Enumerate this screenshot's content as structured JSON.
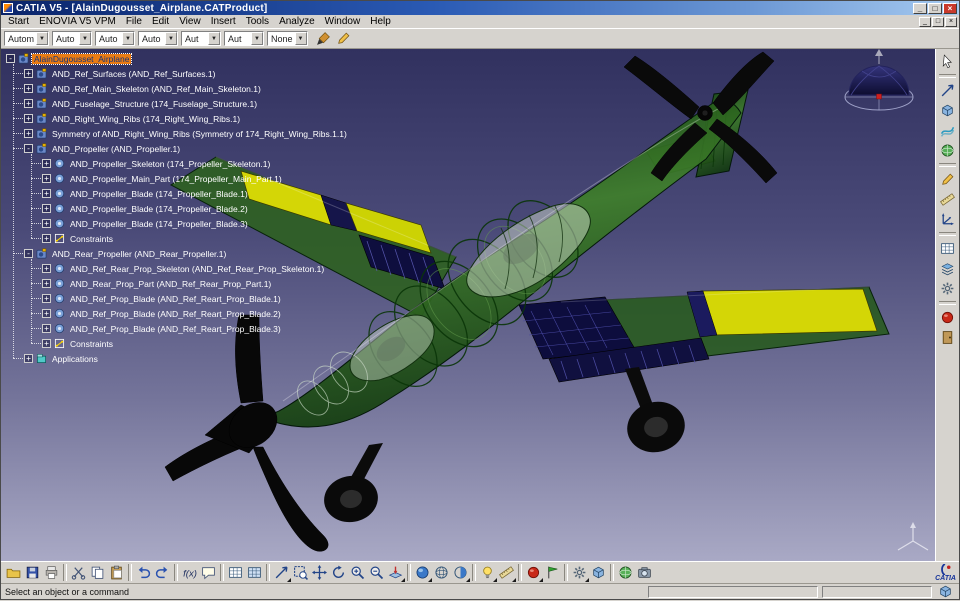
{
  "window": {
    "title": "CATIA V5 - [AlainDugousset_Airplane.CATProduct]",
    "buttons": [
      {
        "name": "minimize-button",
        "glyph": "_"
      },
      {
        "name": "maximize-button",
        "glyph": "□"
      },
      {
        "name": "close-button",
        "glyph": "×"
      }
    ],
    "mdi_buttons": [
      {
        "name": "mdi-minimize-button",
        "glyph": "_"
      },
      {
        "name": "mdi-restore-button",
        "glyph": "□"
      },
      {
        "name": "mdi-close-button",
        "glyph": "×"
      }
    ]
  },
  "menu": {
    "items": [
      "Start",
      "ENOVIA V5 VPM",
      "File",
      "Edit",
      "View",
      "Insert",
      "Tools",
      "Analyze",
      "Window",
      "Help"
    ]
  },
  "toolbar": {
    "combos": [
      {
        "name": "auto-color-combo",
        "value": "Autom"
      },
      {
        "name": "auto-1-combo",
        "value": "Auto"
      },
      {
        "name": "auto-2-combo",
        "value": "Auto"
      },
      {
        "name": "auto-3-combo",
        "value": "Auto"
      },
      {
        "name": "aut-1-combo",
        "value": "Aut"
      },
      {
        "name": "aut-2-combo",
        "value": "Aut"
      },
      {
        "name": "point-symbol-combo",
        "value": "None"
      }
    ],
    "icons": [
      {
        "name": "paint-icon",
        "type": "brush"
      },
      {
        "name": "pencil-icon",
        "type": "pencil"
      }
    ]
  },
  "tree": {
    "items": [
      {
        "label": "AlainDugousset_Airplane",
        "level": 0,
        "expand": "minus",
        "icon": "product",
        "selected": true
      },
      {
        "label": "AND_Ref_Surfaces (AND_Ref_Surfaces.1)",
        "level": 1,
        "expand": "plus",
        "icon": "product",
        "selected": false
      },
      {
        "label": "AND_Ref_Main_Skeleton (AND_Ref_Main_Skeleton.1)",
        "level": 1,
        "expand": "plus",
        "icon": "product",
        "selected": false
      },
      {
        "label": "AND_Fuselage_Structure (174_Fuselage_Structure.1)",
        "level": 1,
        "expand": "plus",
        "icon": "product",
        "selected": false
      },
      {
        "label": "AND_Right_Wing_Ribs (174_Right_Wing_Ribs.1)",
        "level": 1,
        "expand": "plus",
        "icon": "product",
        "selected": false
      },
      {
        "label": "Symmetry of AND_Right_Wing_Ribs (Symmetry of 174_Right_Wing_Ribs.1.1)",
        "level": 1,
        "expand": "plus",
        "icon": "product",
        "selected": false
      },
      {
        "label": "AND_Propeller (AND_Propeller.1)",
        "level": 1,
        "expand": "minus",
        "icon": "product",
        "selected": false
      },
      {
        "label": "AND_Propeller_Skeleton (174_Propeller_Skeleton.1)",
        "level": 2,
        "expand": "plus",
        "icon": "part",
        "selected": false
      },
      {
        "label": "AND_Propeller_Main_Part (174_Propeller_Main_Part.1)",
        "level": 2,
        "expand": "plus",
        "icon": "part",
        "selected": false
      },
      {
        "label": "AND_Propeller_Blade (174_Propeller_Blade.1)",
        "level": 2,
        "expand": "plus",
        "icon": "part",
        "selected": false
      },
      {
        "label": "AND_Propeller_Blade (174_Propeller_Blade.2)",
        "level": 2,
        "expand": "plus",
        "icon": "part",
        "selected": false
      },
      {
        "label": "AND_Propeller_Blade (174_Propeller_Blade.3)",
        "level": 2,
        "expand": "plus",
        "icon": "part",
        "selected": false
      },
      {
        "label": "Constraints",
        "level": 2,
        "expand": "plus",
        "icon": "constraints",
        "selected": false
      },
      {
        "label": "AND_Rear_Propeller (AND_Rear_Propeller.1)",
        "level": 1,
        "expand": "minus",
        "icon": "product",
        "selected": false
      },
      {
        "label": "AND_Ref_Rear_Prop_Skeleton (AND_Ref_Rear_Prop_Skeleton.1)",
        "level": 2,
        "expand": "plus",
        "icon": "part",
        "selected": false
      },
      {
        "label": "AND_Rear_Prop_Part (AND_Ref_Rear_Prop_Part.1)",
        "level": 2,
        "expand": "plus",
        "icon": "part",
        "selected": false
      },
      {
        "label": "AND_Ref_Prop_Blade (AND_Ref_Reart_Prop_Blade.1)",
        "level": 2,
        "expand": "plus",
        "icon": "part",
        "selected": false
      },
      {
        "label": "AND_Ref_Prop_Blade (AND_Ref_Reart_Prop_Blade.2)",
        "level": 2,
        "expand": "plus",
        "icon": "part",
        "selected": false
      },
      {
        "label": "AND_Ref_Prop_Blade (AND_Ref_Reart_Prop_Blade.3)",
        "level": 2,
        "expand": "plus",
        "icon": "part",
        "selected": false
      },
      {
        "label": "Constraints",
        "level": 2,
        "expand": "plus",
        "icon": "constraints",
        "selected": false
      },
      {
        "label": "Applications",
        "level": 1,
        "expand": "plus",
        "icon": "applications",
        "selected": false
      }
    ]
  },
  "viewport": {
    "colors": {
      "top": "#31315f",
      "bottom": "#a9a9c5",
      "selection_bg": "#e97b13",
      "selection_text": "#16347c",
      "fuselage_green": "#3f7f2b",
      "panel_yellow": "#d4d606",
      "structure_navy": "#10103f",
      "propeller_black": "#0a0a0a"
    }
  },
  "right_toolbar": {
    "icons": [
      {
        "name": "select-icon",
        "type": "cursor"
      },
      {
        "type": "sep"
      },
      {
        "name": "fly-workbench-icon",
        "type": "jet"
      },
      {
        "name": "part-workbench-icon",
        "type": "cube"
      },
      {
        "name": "surface-workbench-icon",
        "type": "surface"
      },
      {
        "name": "dmu-world-icon",
        "type": "world"
      },
      {
        "type": "sep"
      },
      {
        "name": "sketcher-icon",
        "type": "pencil"
      },
      {
        "name": "measure-tool-icon",
        "type": "ruler"
      },
      {
        "name": "axis-system-icon",
        "type": "axis3"
      },
      {
        "type": "sep"
      },
      {
        "name": "grid-tool-icon",
        "type": "grid"
      },
      {
        "name": "layers-icon",
        "type": "layers"
      },
      {
        "name": "settings-gear-icon",
        "type": "gear"
      },
      {
        "type": "sep"
      },
      {
        "name": "apply-material-icon",
        "type": "redball"
      },
      {
        "name": "exit-workbench-icon",
        "type": "door"
      }
    ]
  },
  "bottom_toolbar": {
    "logo": "CATIA",
    "icons": [
      {
        "name": "open-icon",
        "type": "folder"
      },
      {
        "name": "save-icon",
        "type": "floppy"
      },
      {
        "name": "print-icon",
        "type": "printer"
      },
      {
        "type": "sep"
      },
      {
        "name": "cut-icon",
        "type": "scissors"
      },
      {
        "name": "copy-icon",
        "type": "copy"
      },
      {
        "name": "paste-icon",
        "type": "paste"
      },
      {
        "type": "sep"
      },
      {
        "name": "undo-icon",
        "type": "undo"
      },
      {
        "name": "redo-icon",
        "type": "redo"
      },
      {
        "type": "sep"
      },
      {
        "name": "knowledge-fx-icon",
        "type": "fx"
      },
      {
        "name": "annotation-icon",
        "type": "bubble"
      },
      {
        "type": "sep"
      },
      {
        "name": "design-table-icon",
        "type": "grid"
      },
      {
        "name": "catalog-icon",
        "type": "gridblue"
      },
      {
        "type": "sep"
      },
      {
        "name": "fly-mode-icon",
        "type": "jet",
        "arrow": true
      },
      {
        "name": "fit-all-icon",
        "type": "fit"
      },
      {
        "name": "pan-icon",
        "type": "pan"
      },
      {
        "name": "rotate-icon",
        "type": "rotate"
      },
      {
        "name": "zoom-in-icon",
        "type": "zoomin"
      },
      {
        "name": "zoom-out-icon",
        "type": "zoomout"
      },
      {
        "name": "normal-view-icon",
        "type": "normal",
        "arrow": true
      },
      {
        "type": "sep"
      },
      {
        "name": "shaded-icon",
        "type": "sphere",
        "arrow": true
      },
      {
        "name": "wireframe-icon",
        "type": "spherewire"
      },
      {
        "name": "render-style-icon",
        "type": "spherehalf",
        "arrow": true
      },
      {
        "type": "sep"
      },
      {
        "name": "hide-show-icon",
        "type": "light",
        "arrow": true
      },
      {
        "name": "measure-icon",
        "type": "ruler",
        "arrow": true
      },
      {
        "type": "sep"
      },
      {
        "name": "material-icon",
        "type": "redball",
        "arrow": true
      },
      {
        "name": "flag-note-icon",
        "type": "flag"
      },
      {
        "type": "sep"
      },
      {
        "name": "options-gear-icon",
        "type": "gear",
        "arrow": true
      },
      {
        "name": "product-cube-icon",
        "type": "cube"
      },
      {
        "type": "sep"
      },
      {
        "name": "world-icon",
        "type": "world"
      },
      {
        "name": "camera-icon",
        "type": "camera"
      }
    ]
  },
  "status_bar": {
    "message": "Select an object or a command",
    "fields": [
      "",
      ""
    ]
  }
}
